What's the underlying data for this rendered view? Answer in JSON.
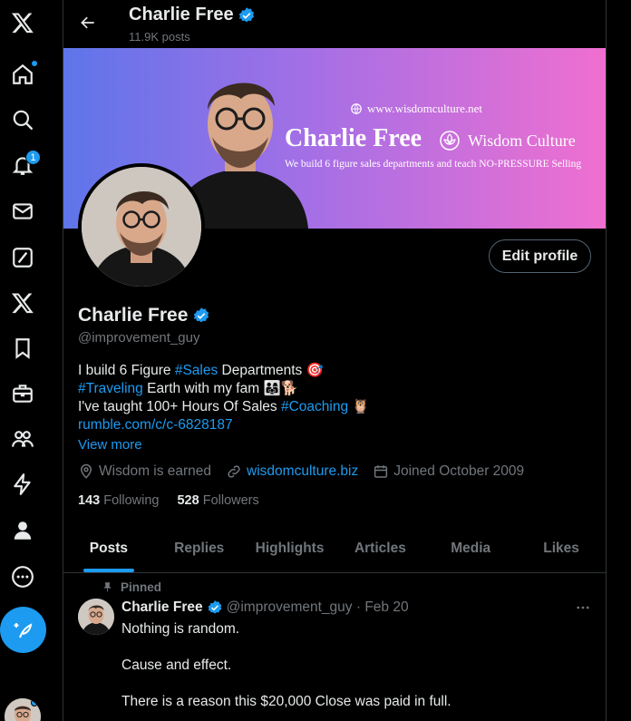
{
  "app": {
    "brand_icon": "x-logo-icon",
    "accent": "#1d9bf0"
  },
  "nav": {
    "items": [
      {
        "name": "x-logo-icon"
      },
      {
        "name": "home-icon"
      },
      {
        "name": "explore-icon"
      },
      {
        "name": "notifications-icon",
        "badge": "1"
      },
      {
        "name": "messages-icon"
      },
      {
        "name": "grok-icon"
      },
      {
        "name": "premium-x-icon"
      },
      {
        "name": "bookmarks-icon"
      },
      {
        "name": "jobs-icon"
      },
      {
        "name": "communities-icon"
      },
      {
        "name": "verified-orgs-icon"
      },
      {
        "name": "profile-icon"
      },
      {
        "name": "more-icon"
      }
    ]
  },
  "header": {
    "name": "Charlie Free",
    "post_count": "11.9K posts"
  },
  "banner": {
    "url": "www.wisdomculture.net",
    "name": "Charlie Free",
    "brand": "Wisdom Culture",
    "tagline": "We build 6 figure sales departments and teach NO-PRESSURE Selling"
  },
  "profile": {
    "edit_label": "Edit profile",
    "display_name": "Charlie Free",
    "handle": "@improvement_guy",
    "bio": {
      "l1_a": "I build 6 Figure ",
      "l1_tag": "#Sales",
      "l1_b": " Departments 🎯",
      "l2_tag": "#Traveling",
      "l2_b": " Earth with my fam 👨‍👩‍👧🐕",
      "l3_a": "I've taught 100+ Hours Of Sales ",
      "l3_tag": "#Coaching",
      "l3_b": " 🦉",
      "l4_link": "rumble.com/c/c-6828187"
    },
    "view_more": "View more",
    "location": "Wisdom is earned",
    "website": "wisdomculture.biz",
    "joined": "Joined October 2009",
    "following_count": "143",
    "following_label": "Following",
    "followers_count": "528",
    "followers_label": "Followers"
  },
  "tabs": [
    {
      "label": "Posts"
    },
    {
      "label": "Replies"
    },
    {
      "label": "Highlights"
    },
    {
      "label": "Articles"
    },
    {
      "label": "Media"
    },
    {
      "label": "Likes"
    }
  ],
  "post": {
    "pinned_label": "Pinned",
    "author": "Charlie Free",
    "handle_date": "@improvement_guy · Feb 20",
    "text": "Nothing is random.\n\nCause and effect.\n\nThere is a reason this $20,000 Close was paid in full."
  }
}
